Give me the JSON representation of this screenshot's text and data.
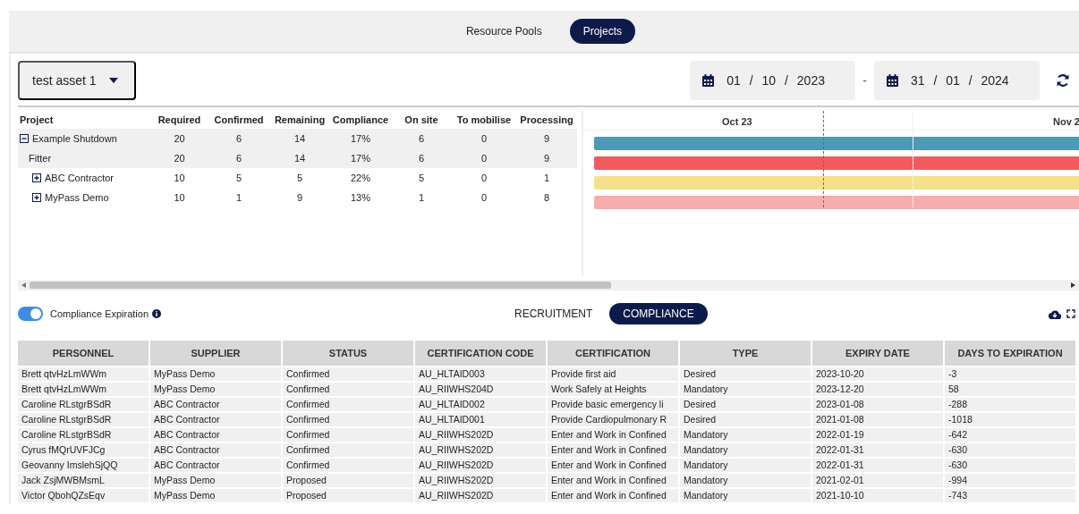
{
  "top_tabs": [
    {
      "label": "Resource Pools",
      "selected": false
    },
    {
      "label": "Projects",
      "selected": true
    }
  ],
  "asset_select": {
    "value": "test asset 1"
  },
  "date_range": {
    "start": "01 / 10 / 2023",
    "separator": "-",
    "end": "31 / 01 / 2024"
  },
  "project_table": {
    "columns": [
      "Project",
      "Required",
      "Confirmed",
      "Remaining",
      "Compliance",
      "On site",
      "To mobilise",
      "Processing"
    ],
    "rows": [
      {
        "name": "Example Shutdown",
        "kind": "group",
        "expanded": true,
        "selected": true,
        "color": "#4a9ab8",
        "values": [
          "20",
          "6",
          "14",
          "17%",
          "6",
          "0",
          "9"
        ],
        "children": [
          {
            "name": "Fitter",
            "kind": "leaf",
            "selected": true,
            "color": "#f05c5e",
            "values": [
              "20",
              "6",
              "14",
              "17%",
              "6",
              "0",
              "9"
            ]
          },
          {
            "name": "ABC Contractor",
            "kind": "group",
            "expanded": false,
            "selected": false,
            "color": "#f5e08c",
            "values": [
              "10",
              "5",
              "5",
              "22%",
              "5",
              "0",
              "1"
            ]
          },
          {
            "name": "MyPass Demo",
            "kind": "group",
            "expanded": false,
            "selected": false,
            "color": "#f7adad",
            "values": [
              "10",
              "1",
              "9",
              "13%",
              "1",
              "0",
              "8"
            ]
          }
        ]
      }
    ]
  },
  "timeline": {
    "headers": [
      "Oct 23",
      "Nov 2"
    ]
  },
  "compliance_toggle": {
    "label": "Compliance Expiration",
    "on": true
  },
  "view_tabs": [
    {
      "label": "RECRUITMENT",
      "selected": false
    },
    {
      "label": "COMPLIANCE",
      "selected": true
    }
  ],
  "table": {
    "columns": [
      "PERSONNEL",
      "SUPPLIER",
      "STATUS",
      "CERTIFICATION CODE",
      "CERTIFICATION",
      "TYPE",
      "EXPIRY DATE",
      "DAYS TO EXPIRATION"
    ],
    "rows": [
      [
        "Brett qtvHzLmWWm",
        "MyPass Demo",
        "Confirmed",
        "AU_HLTAID003",
        "Provide first aid",
        "Desired",
        "2023-10-20",
        "-3"
      ],
      [
        "Brett qtvHzLmWWm",
        "MyPass Demo",
        "Confirmed",
        "AU_RIIWHS204D",
        "Work Safely at Heights",
        "Mandatory",
        "2023-12-20",
        "58"
      ],
      [
        "Caroline RLstgrBSdR",
        "ABC Contractor",
        "Confirmed",
        "AU_HLTAID002",
        "Provide basic emergency li",
        "Desired",
        "2023-01-08",
        "-288"
      ],
      [
        "Caroline RLstgrBSdR",
        "ABC Contractor",
        "Confirmed",
        "AU_HLTAID001",
        "Provide Cardiopulmonary R",
        "Desired",
        "2021-01-08",
        "-1018"
      ],
      [
        "Caroline RLstgrBSdR",
        "ABC Contractor",
        "Confirmed",
        "AU_RIIWHS202D",
        "Enter and Work in Confined",
        "Mandatory",
        "2022-01-19",
        "-642"
      ],
      [
        "Cyrus fMQrUVFJCg",
        "ABC Contractor",
        "Confirmed",
        "AU_RIIWHS202D",
        "Enter and Work in Confined",
        "Mandatory",
        "2022-01-31",
        "-630"
      ],
      [
        "Geovanny ImslehSjQQ",
        "ABC Contractor",
        "Confirmed",
        "AU_RIIWHS202D",
        "Enter and Work in Confined",
        "Mandatory",
        "2022-01-31",
        "-630"
      ],
      [
        "Jack ZsjMWBMsmL",
        "MyPass Demo",
        "Proposed",
        "AU_RIIWHS202D",
        "Enter and Work in Confined",
        "Mandatory",
        "2021-02-01",
        "-994"
      ],
      [
        "Victor QbohQZsEqv",
        "MyPass Demo",
        "Proposed",
        "AU_RIIWHS202D",
        "Enter and Work in Confined",
        "Mandatory",
        "2021-10-10",
        "-743"
      ]
    ]
  }
}
